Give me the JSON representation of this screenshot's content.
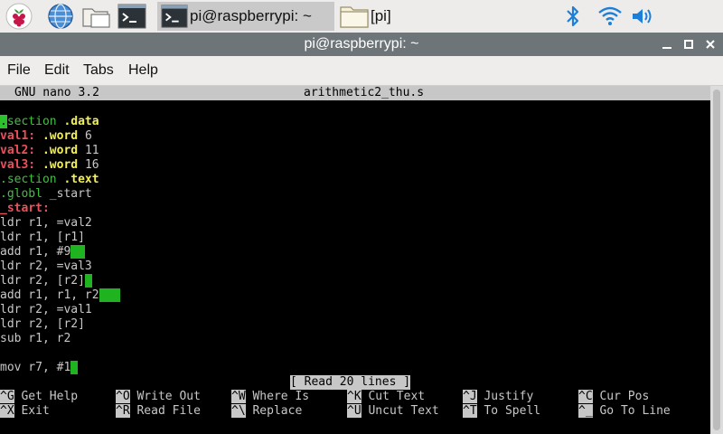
{
  "panel": {
    "launchers": [
      {
        "icon": "raspberry-menu-icon"
      },
      {
        "icon": "web-browser-globe-icon"
      },
      {
        "icon": "file-manager-icon"
      },
      {
        "icon": "terminal-icon"
      }
    ],
    "tasks": [
      {
        "label": "pi@raspberrypi: ~",
        "icon": "terminal-icon"
      },
      {
        "label": "[pi]",
        "icon": "folder-icon"
      }
    ],
    "tray": [
      "bluetooth-icon",
      "wifi-icon",
      "volume-icon"
    ]
  },
  "window": {
    "title": "pi@raspberrypi: ~",
    "controls": [
      "minimize",
      "maximize",
      "close"
    ]
  },
  "menubar": [
    "File",
    "Edit",
    "Tabs",
    "Help"
  ],
  "nano": {
    "version": "GNU nano 3.2",
    "filename": "arithmetic2_thu.s",
    "status": "[ Read 20 lines ]",
    "lines": [
      "",
      ".section .data",
      "val1: .word 6",
      "val2: .word 11",
      "val3: .word 16",
      ".section .text",
      ".globl _start",
      "_start:",
      "ldr r1, =val2",
      "ldr r1, [r1]",
      "add r1, #9",
      "ldr r2, =val3",
      "ldr r2, [r2]",
      "add r1, r1, r2",
      "ldr r2, =val1",
      "ldr r2, [r2]",
      "sub r1, r2",
      "",
      "mov r7, #1"
    ],
    "shortcuts": [
      {
        "key": "^G",
        "label": "Get Help"
      },
      {
        "key": "^O",
        "label": "Write Out"
      },
      {
        "key": "^W",
        "label": "Where Is"
      },
      {
        "key": "^K",
        "label": "Cut Text"
      },
      {
        "key": "^J",
        "label": "Justify"
      },
      {
        "key": "^C",
        "label": "Cur Pos"
      },
      {
        "key": "^X",
        "label": "Exit"
      },
      {
        "key": "^R",
        "label": "Read File"
      },
      {
        "key": "^\\",
        "label": "Replace"
      },
      {
        "key": "^U",
        "label": "Uncut Text"
      },
      {
        "key": "^T",
        "label": "To Spell"
      },
      {
        "key": "^_",
        "label": "Go To Line"
      }
    ]
  }
}
